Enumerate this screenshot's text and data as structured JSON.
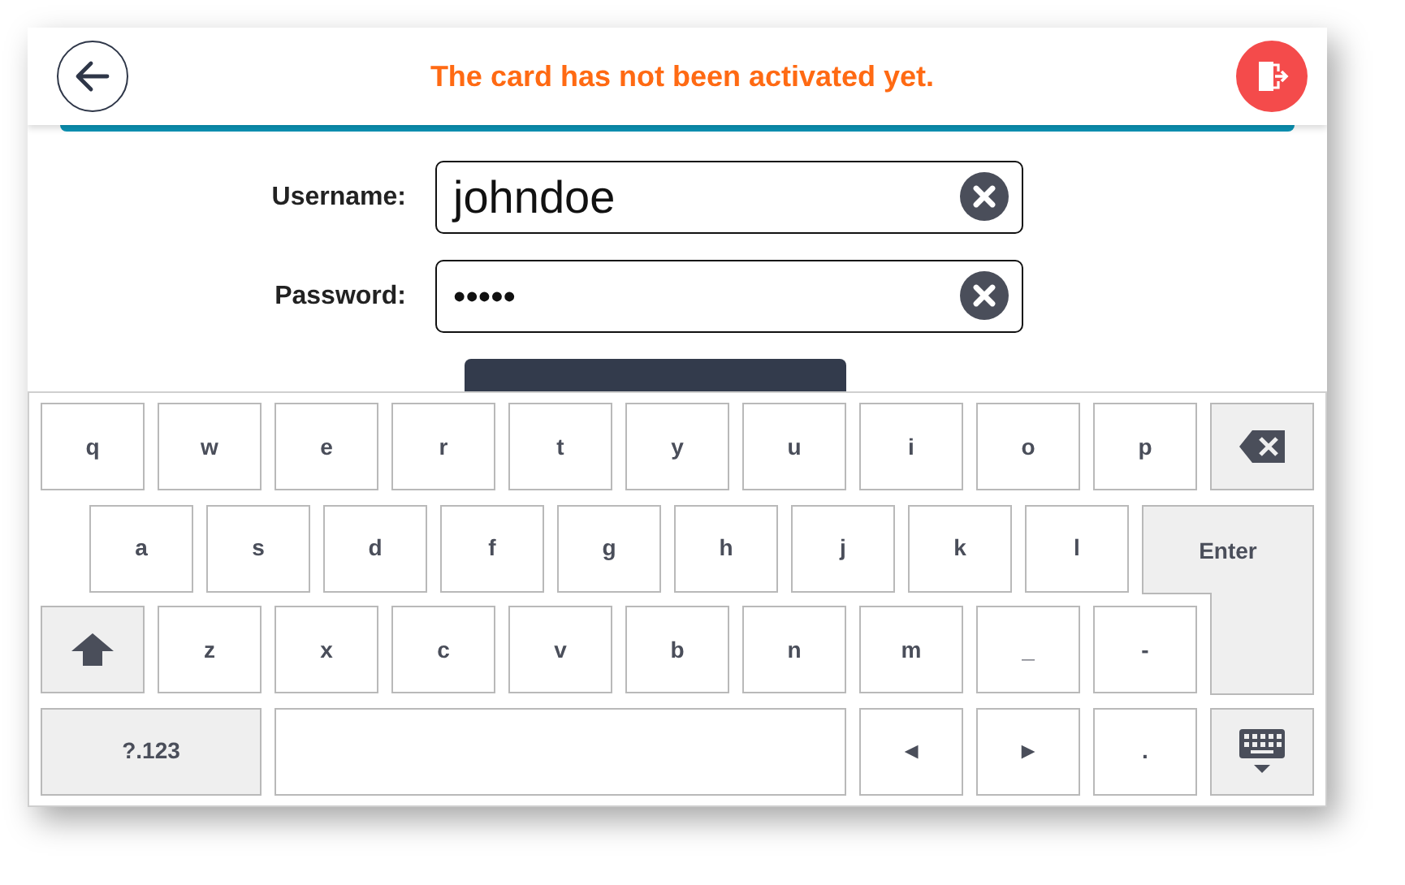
{
  "header": {
    "title": "The card has not been activated yet."
  },
  "form": {
    "fields": [
      {
        "label": "Username:",
        "value": "johndoe"
      },
      {
        "label": "Password:",
        "value": "•••••"
      }
    ]
  },
  "keyboard": {
    "rows": [
      [
        {
          "kind": "char",
          "label": "q"
        },
        {
          "kind": "char",
          "label": "w"
        },
        {
          "kind": "char",
          "label": "e"
        },
        {
          "kind": "char",
          "label": "r"
        },
        {
          "kind": "char",
          "label": "t"
        },
        {
          "kind": "char",
          "label": "y"
        },
        {
          "kind": "char",
          "label": "u"
        },
        {
          "kind": "char",
          "label": "i"
        },
        {
          "kind": "char",
          "label": "o"
        },
        {
          "kind": "char",
          "label": "p"
        },
        {
          "kind": "backspace"
        }
      ],
      [
        {
          "kind": "char",
          "label": "a"
        },
        {
          "kind": "char",
          "label": "s"
        },
        {
          "kind": "char",
          "label": "d"
        },
        {
          "kind": "char",
          "label": "f"
        },
        {
          "kind": "char",
          "label": "g"
        },
        {
          "kind": "char",
          "label": "h"
        },
        {
          "kind": "char",
          "label": "j"
        },
        {
          "kind": "char",
          "label": "k"
        },
        {
          "kind": "char",
          "label": "l"
        },
        {
          "kind": "enter",
          "label": "Enter"
        }
      ],
      [
        {
          "kind": "shift"
        },
        {
          "kind": "char",
          "label": "z"
        },
        {
          "kind": "char",
          "label": "x"
        },
        {
          "kind": "char",
          "label": "c"
        },
        {
          "kind": "char",
          "label": "v"
        },
        {
          "kind": "char",
          "label": "b"
        },
        {
          "kind": "char",
          "label": "n"
        },
        {
          "kind": "char",
          "label": "m"
        },
        {
          "kind": "char",
          "label": "_"
        },
        {
          "kind": "char",
          "label": "-"
        }
      ],
      [
        {
          "kind": "symbols",
          "label": "?.123"
        },
        {
          "kind": "merged"
        },
        {
          "kind": "space"
        },
        {
          "kind": "merged"
        },
        {
          "kind": "merged"
        },
        {
          "kind": "merged"
        },
        {
          "kind": "merged"
        },
        {
          "kind": "char",
          "label": "◄"
        },
        {
          "kind": "char",
          "label": "►"
        },
        {
          "kind": "char",
          "label": "."
        },
        {
          "kind": "hide"
        }
      ]
    ]
  }
}
